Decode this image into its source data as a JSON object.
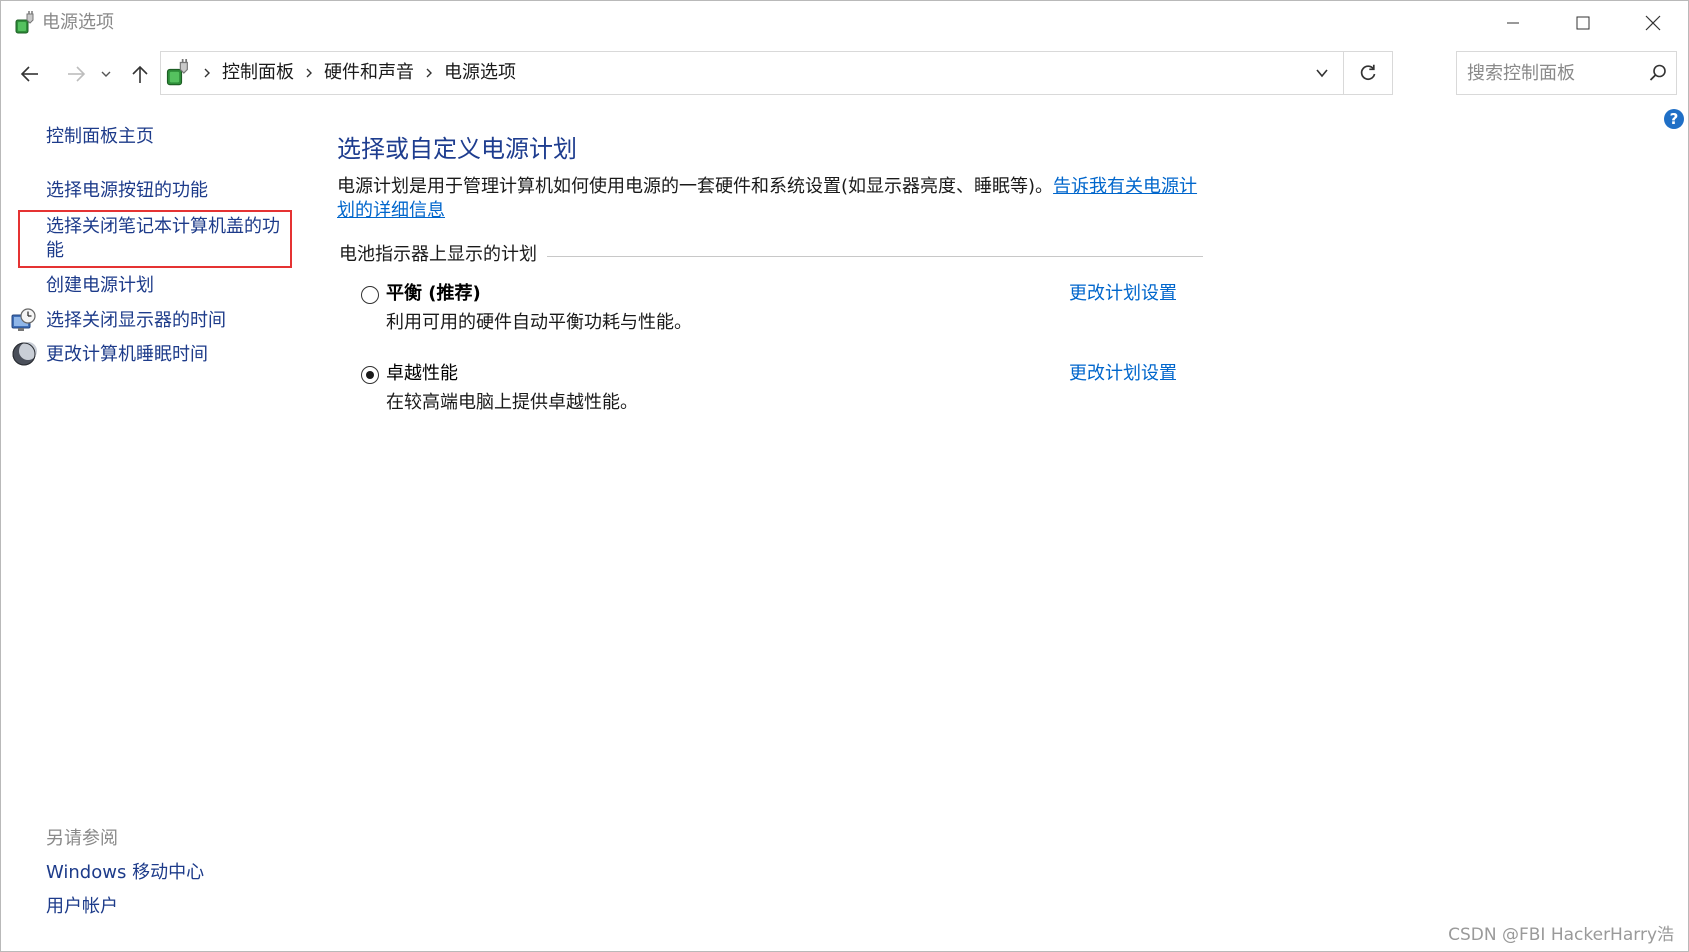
{
  "window": {
    "title": "电源选项",
    "icons": {
      "app": "power-options-icon",
      "minimize": "minimize-icon",
      "maximize": "maximize-icon",
      "close": "close-icon"
    }
  },
  "nav": {
    "back_icon": "arrow-left-icon",
    "forward_icon": "arrow-right-icon",
    "recent_icon": "chevron-down-icon",
    "up_icon": "arrow-up-icon"
  },
  "address": {
    "breadcrumbs": [
      "控制面板",
      "硬件和声音",
      "电源选项"
    ],
    "refresh_icon": "refresh-icon",
    "dropdown_icon": "chevron-down-icon"
  },
  "search": {
    "placeholder": "搜索控制面板",
    "value": ""
  },
  "sidebar": {
    "home_link": "控制面板主页",
    "links": [
      {
        "label": "选择电源按钮的功能",
        "icon": null
      },
      {
        "label": "选择关闭笔记本计算机盖的功能",
        "icon": null,
        "highlighted": true
      },
      {
        "label": "创建电源计划",
        "icon": null
      },
      {
        "label": "选择关闭显示器的时间",
        "icon": "display-clock-icon"
      },
      {
        "label": "更改计算机睡眠时间",
        "icon": "sleep-moon-icon"
      }
    ],
    "see_also_heading": "另请参阅",
    "see_also_links": [
      "Windows 移动中心",
      "用户帐户"
    ]
  },
  "main": {
    "title": "选择或自定义电源计划",
    "description": "电源计划是用于管理计算机如何使用电源的一套硬件和系统设置(如显示器亮度、睡眠等)。",
    "description_link": "告诉我有关电源计划的详细信息",
    "group_label": "电池指示器上显示的计划",
    "plans": [
      {
        "name": "平衡 (推荐)",
        "description": "利用可用的硬件自动平衡功耗与性能。",
        "selected": false,
        "link": "更改计划设置"
      },
      {
        "name": "卓越性能",
        "description": "在较高端电脑上提供卓越性能。",
        "selected": true,
        "link": "更改计划设置"
      }
    ]
  },
  "help_icon": "help-icon",
  "watermark": "CSDN @FBI HackerHarry浩",
  "colors": {
    "link_blue": "#0066cc",
    "title_blue": "#1e3d8f",
    "sidebar_link": "#1d3b8a",
    "highlight_red": "#e53333",
    "muted_gray": "#8a8a8a"
  }
}
